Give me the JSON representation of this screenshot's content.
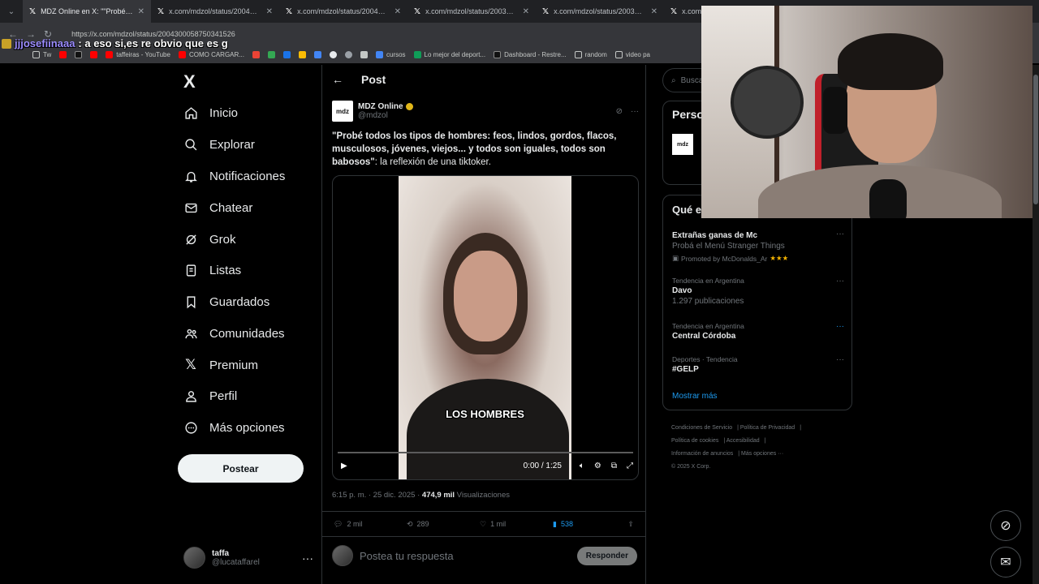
{
  "browser": {
    "tabs": [
      {
        "title": "MDZ Online en X: \"\"Probé todo",
        "active": true
      },
      {
        "title": "x.com/mdzol/status/2004294205",
        "active": false
      },
      {
        "title": "x.com/mdzol/status/2004208155",
        "active": false
      },
      {
        "title": "x.com/mdzol/status/2003573726",
        "active": false
      },
      {
        "title": "x.com/mdzol/status/2003507283",
        "active": false
      },
      {
        "title": "x.com",
        "active": false
      }
    ],
    "url": "https://x.com/mdzol/status/2004300058750341526",
    "bookmarks": [
      "Tw",
      "taffeiras - YouTube",
      "COMO CARGAR...",
      "cursos",
      "Lo mejor del deport...",
      "Dashboard - Restre...",
      "random",
      "video pa"
    ]
  },
  "chat_overlay": {
    "user": "jjjosefiinaaa",
    "message": ": a eso si,es re obvio que es g"
  },
  "sidebar": {
    "logo": "X",
    "items": [
      {
        "label": "Inicio",
        "icon": "home-icon"
      },
      {
        "label": "Explorar",
        "icon": "search-icon"
      },
      {
        "label": "Notificaciones",
        "icon": "bell-icon"
      },
      {
        "label": "Chatear",
        "icon": "mail-icon"
      },
      {
        "label": "Grok",
        "icon": "grok-icon"
      },
      {
        "label": "Listas",
        "icon": "list-icon"
      },
      {
        "label": "Guardados",
        "icon": "bookmark-icon"
      },
      {
        "label": "Comunidades",
        "icon": "people-icon"
      },
      {
        "label": "Premium",
        "icon": "x-icon"
      },
      {
        "label": "Perfil",
        "icon": "person-icon"
      },
      {
        "label": "Más opciones",
        "icon": "more-circle-icon"
      }
    ],
    "post_button": "Postear",
    "profile": {
      "name": "taffa",
      "handle": "@lucataffarel"
    }
  },
  "main": {
    "header_title": "Post",
    "author": {
      "logo": "mdz",
      "name": "MDZ Online",
      "handle": "@mdzol"
    },
    "text_bold": "\"Probé todos los tipos de hombres: feos, lindos, gordos, flacos, musculosos, jóvenes, viejos... y todos son iguales, todos son babosos\"",
    "text_rest": ": la reflexión de una tiktoker.",
    "video": {
      "caption": "LOS HOMBRES",
      "time": "0:00 / 1:25"
    },
    "meta": {
      "time": "6:15 p. m. · 25 dic. 2025 · ",
      "views": "474,9 mil",
      "views_label": " Visualizaciones"
    },
    "engagement": {
      "replies": "2 mil",
      "reposts": "289",
      "likes": "1 mil",
      "bookmarks": "538"
    },
    "reply_placeholder": "Postea tu respuesta",
    "reply_button": "Responder"
  },
  "right": {
    "search_placeholder": "Busca",
    "card1_title": "Perso",
    "card1_logo": "mdz",
    "trends_title": "Qué e",
    "trends": [
      {
        "context": "",
        "title": "Extrañas ganas de Mc",
        "sub": "Probá el Menú Stranger Things",
        "promo": "Promoted by McDonalds_Ar",
        "stars": "★★★"
      },
      {
        "context": "Tendencia en Argentina",
        "title": "Davo",
        "sub": "1.297 publicaciones"
      },
      {
        "context": "Tendencia en Argentina",
        "title": "Central Córdoba",
        "sub": ""
      },
      {
        "context": "Deportes · Tendencia",
        "title": "#GELP",
        "sub": ""
      }
    ],
    "show_more": "Mostrar más",
    "footer": [
      "Condiciones de Servicio",
      "Política de Privacidad",
      "Política de cookies",
      "Accesibilidad",
      "Información de anuncios",
      "Más opciones ···",
      "© 2025 X Corp."
    ]
  }
}
